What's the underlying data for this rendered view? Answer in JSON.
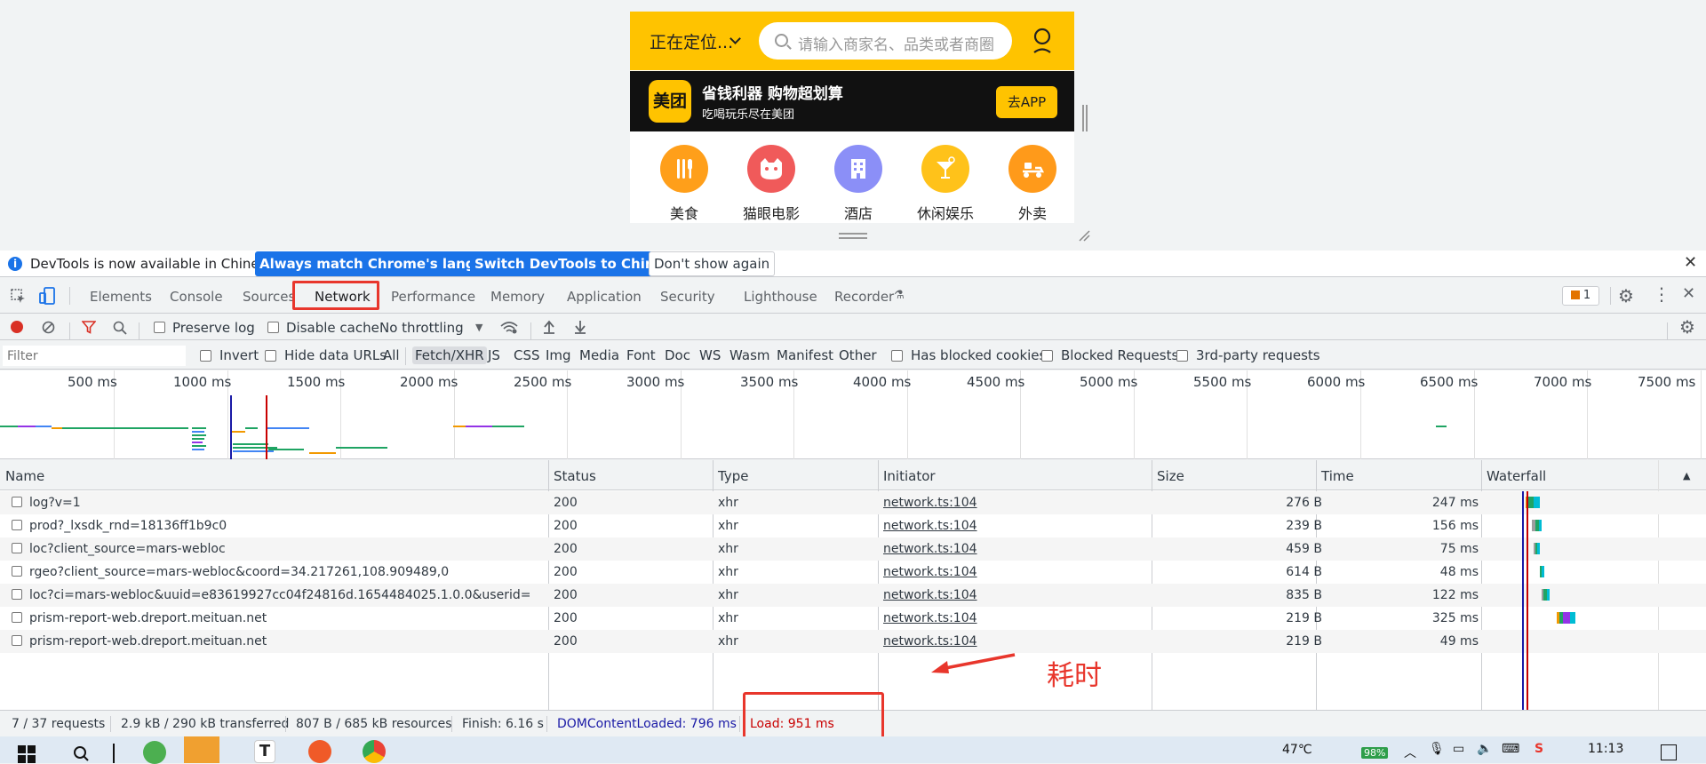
{
  "mobile": {
    "location": "正在定位...",
    "search_placeholder": "请输入商家名、品类或者商圈",
    "banner_logo": "美团",
    "banner_title": "省钱利器 购物超划算",
    "banner_subtitle": "吃喝玩乐尽在美团",
    "banner_button": "去APP",
    "categories": [
      {
        "label": "美食",
        "color": "#ff9f1a"
      },
      {
        "label": "猫眼电影",
        "color": "#f05a5a"
      },
      {
        "label": "酒店",
        "color": "#8b8ff7"
      },
      {
        "label": "休闲娱乐",
        "color": "#ffc21a"
      },
      {
        "label": "外卖",
        "color": "#ff9a1a"
      }
    ]
  },
  "infobar": {
    "message": "DevTools is now available in Chinese!",
    "btn_match": "Always match Chrome's language",
    "btn_switch": "Switch DevTools to Chinese",
    "btn_dont": "Don't show again"
  },
  "tabs": [
    "Elements",
    "Console",
    "Sources",
    "Network",
    "Performance",
    "Memory",
    "Application",
    "Security",
    "Lighthouse",
    "Recorder"
  ],
  "issues_count": "1",
  "toolbar": {
    "preserve_log": "Preserve log",
    "disable_cache": "Disable cache",
    "throttling": "No throttling"
  },
  "filterbar": {
    "placeholder": "Filter",
    "invert": "Invert",
    "hide_data_urls": "Hide data URLs",
    "types": [
      "All",
      "Fetch/XHR",
      "JS",
      "CSS",
      "Img",
      "Media",
      "Font",
      "Doc",
      "WS",
      "Wasm",
      "Manifest",
      "Other"
    ],
    "selected_type": "Fetch/XHR",
    "has_blocked_cookies": "Has blocked cookies",
    "blocked_requests": "Blocked Requests",
    "third_party": "3rd-party requests"
  },
  "overview_ticks": [
    "500 ms",
    "1000 ms",
    "1500 ms",
    "2000 ms",
    "2500 ms",
    "3000 ms",
    "3500 ms",
    "4000 ms",
    "4500 ms",
    "5000 ms",
    "5500 ms",
    "6000 ms",
    "6500 ms",
    "7000 ms",
    "7500 ms"
  ],
  "columns": [
    "Name",
    "Status",
    "Type",
    "Initiator",
    "Size",
    "Time",
    "Waterfall"
  ],
  "requests": [
    {
      "name": "log?v=1",
      "status": "200",
      "type": "xhr",
      "initiator": "network.ts:104",
      "size": "276 B",
      "time": "247 ms"
    },
    {
      "name": "prod?_lxsdk_rnd=18136ff1b9c0",
      "status": "200",
      "type": "xhr",
      "initiator": "network.ts:104",
      "size": "239 B",
      "time": "156 ms"
    },
    {
      "name": "loc?client_source=mars-webloc",
      "status": "200",
      "type": "xhr",
      "initiator": "network.ts:104",
      "size": "459 B",
      "time": "75 ms"
    },
    {
      "name": "rgeo?client_source=mars-webloc&coord=34.217261,108.909489,0",
      "status": "200",
      "type": "xhr",
      "initiator": "network.ts:104",
      "size": "614 B",
      "time": "48 ms"
    },
    {
      "name": "loc?ci=mars-webloc&uuid=e83619927cc04f24816d.1654484025.1.0.0&userid=",
      "status": "200",
      "type": "xhr",
      "initiator": "network.ts:104",
      "size": "835 B",
      "time": "122 ms"
    },
    {
      "name": "prism-report-web.dreport.meituan.net",
      "status": "200",
      "type": "xhr",
      "initiator": "network.ts:104",
      "size": "219 B",
      "time": "325 ms"
    },
    {
      "name": "prism-report-web.dreport.meituan.net",
      "status": "200",
      "type": "xhr",
      "initiator": "network.ts:104",
      "size": "219 B",
      "time": "49 ms"
    }
  ],
  "annotation": "耗时",
  "status": {
    "requests": "7 / 37 requests",
    "transferred": "2.9 kB / 290 kB transferred",
    "resources": "807 B / 685 kB resources",
    "finish": "Finish: 6.16 s",
    "dcl": "DOMContentLoaded: 796 ms",
    "load": "Load: 951 ms"
  },
  "taskbar": {
    "temperature": "47℃",
    "battery": "98%",
    "time": "11:13"
  },
  "colors": {
    "meituan_yellow": "#ffc300",
    "devtools_blue": "#1a73e8",
    "annotation_red": "#e8362c",
    "dcl_blue": "#1a1aa6",
    "load_red": "#c80000"
  }
}
